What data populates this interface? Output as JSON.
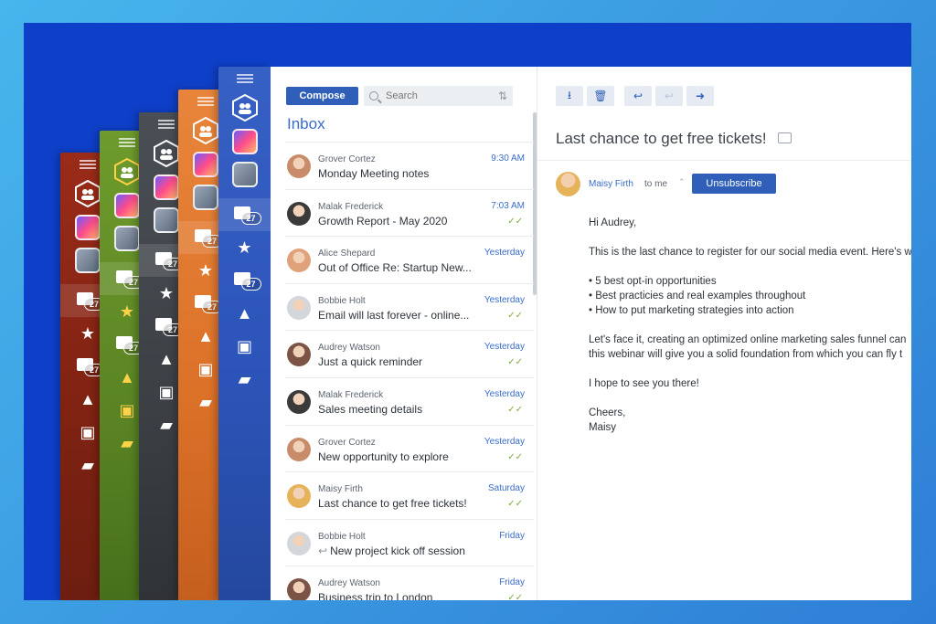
{
  "skins": [
    {
      "badge": "27"
    },
    {
      "badge": "27"
    },
    {
      "badge": "27"
    },
    {
      "badge": "27"
    },
    {
      "badge": "27"
    }
  ],
  "toolbar": {
    "compose_label": "Compose",
    "search_placeholder": "Search"
  },
  "list": {
    "title": "Inbox",
    "messages": [
      {
        "sender": "Grover Cortez",
        "subject": "Monday Meeting notes",
        "time": "9:30 AM",
        "checked": false,
        "replied": false,
        "avatar_color": "#c98c6a"
      },
      {
        "sender": "Malak Frederick",
        "subject": "Growth Report - May 2020",
        "time": "7:03 AM",
        "checked": true,
        "replied": false,
        "avatar_color": "#3a3a3a"
      },
      {
        "sender": "Alice Shepard",
        "subject": "Out of Office Re: Startup New...",
        "time": "Yesterday",
        "checked": false,
        "replied": false,
        "avatar_color": "#e0a27a"
      },
      {
        "sender": "Bobbie Holt",
        "subject": "Email will last forever - online...",
        "time": "Yesterday",
        "checked": true,
        "replied": false,
        "avatar_color": "#d3d6da"
      },
      {
        "sender": "Audrey Watson",
        "subject": "Just a quick reminder",
        "time": "Yesterday",
        "checked": true,
        "replied": false,
        "avatar_color": "#7b5446"
      },
      {
        "sender": "Malak Frederick",
        "subject": "Sales meeting details",
        "time": "Yesterday",
        "checked": true,
        "replied": false,
        "avatar_color": "#3a3a3a"
      },
      {
        "sender": "Grover Cortez",
        "subject": "New opportunity to explore",
        "time": "Yesterday",
        "checked": true,
        "replied": false,
        "avatar_color": "#c98c6a"
      },
      {
        "sender": "Maisy Firth",
        "subject": "Last chance to get free tickets!",
        "time": "Saturday",
        "checked": true,
        "replied": false,
        "avatar_color": "#e6b35a"
      },
      {
        "sender": "Bobbie Holt",
        "subject": "New project kick off session",
        "time": "Friday",
        "checked": false,
        "replied": true,
        "avatar_color": "#d3d6da"
      },
      {
        "sender": "Audrey Watson",
        "subject": "Business trip to London",
        "time": "Friday",
        "checked": true,
        "replied": false,
        "avatar_color": "#7b5446"
      }
    ]
  },
  "reader": {
    "subject": "Last chance to get free tickets!",
    "from": "Maisy Firth",
    "to": "to me",
    "unsubscribe_label": "Unsubscribe",
    "greeting": "Hi Audrey,",
    "intro": "This is the last chance to register for our social media event. Here's w",
    "bullets": [
      "5 best opt-in opportunities",
      "Best practicies and real examples throughout",
      "How to put marketing strategies into action"
    ],
    "para1": "Let's face it, creating an optimized online marketing sales funnel can",
    "para2": "this webinar will give you a solid foundation from which you can fly t",
    "closing": "I hope to see you there!",
    "signoff1": "Cheers,",
    "signoff2": "Maisy"
  },
  "colors": {
    "accent": "#2f5fb8",
    "link": "#3a6ccb",
    "stage_bg": "#0e3fc8",
    "check": "#7cae3c"
  }
}
